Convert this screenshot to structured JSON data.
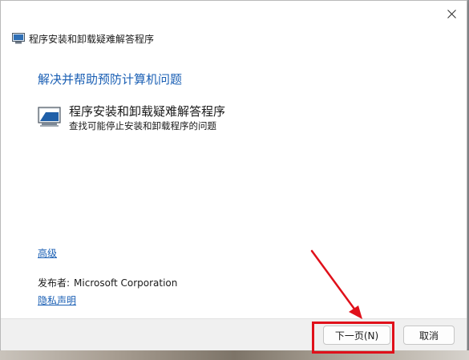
{
  "window": {
    "title": "程序安装和卸载疑难解答程序",
    "close_icon": "close-icon"
  },
  "main": {
    "heading": "解决并帮助预防计算机问题",
    "item": {
      "icon": "troubleshooter-computer-icon",
      "title": "程序安装和卸载疑难解答程序",
      "description": "查找可能停止安装和卸载程序的问题"
    },
    "advanced_link": "高级",
    "publisher_label": "发布者:",
    "publisher_value": "Microsoft Corporation",
    "privacy_link": "隐私声明"
  },
  "footer": {
    "next_label": "下一页(N)",
    "cancel_label": "取消"
  },
  "annotation": {
    "color": "#e0101a"
  }
}
